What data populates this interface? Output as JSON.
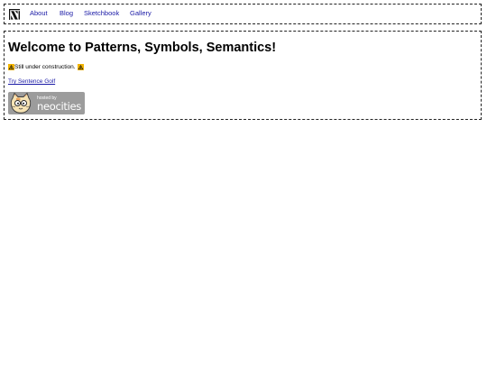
{
  "nav": {
    "logo_icon": "ps-logo-icon",
    "links": [
      {
        "label": "About"
      },
      {
        "label": "Blog"
      },
      {
        "label": "Sketchbook"
      },
      {
        "label": "Gallery"
      }
    ]
  },
  "main": {
    "title": "Welcome to Patterns, Symbols, Semantics!",
    "construction_text": "Still under construction.",
    "construction_icon": "warning-icon",
    "golf_link": "Try Sentence Golf",
    "badge": {
      "small_text": "hosted by",
      "big_text": "neocities",
      "icon": "neocities-cat-icon"
    }
  },
  "colors": {
    "link": "#1a1aa6",
    "badge_bg": "#9c9c9c",
    "warning_bg": "#f2b400"
  }
}
